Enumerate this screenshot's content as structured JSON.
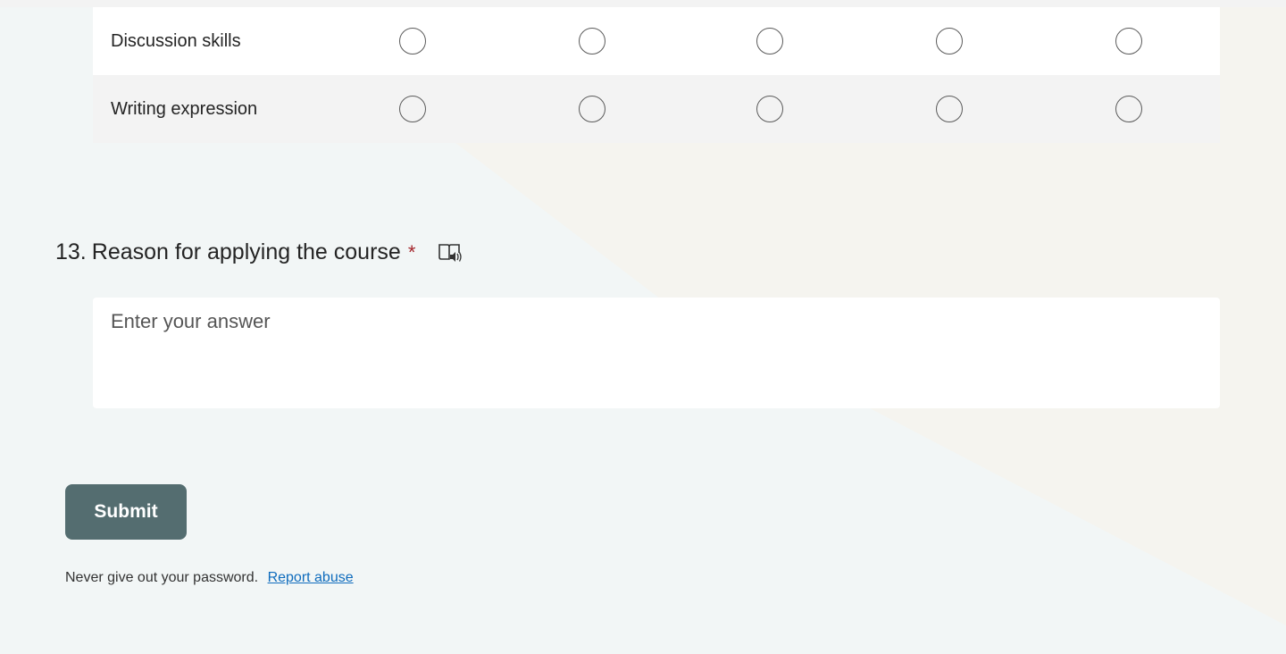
{
  "matrix": {
    "column_count": 5,
    "rows": [
      {
        "label": "Discussion skills"
      },
      {
        "label": "Writing expression"
      }
    ]
  },
  "question": {
    "number": "13.",
    "title": "Reason for applying the course",
    "required_mark": "*",
    "answer_placeholder": "Enter your answer"
  },
  "submit_label": "Submit",
  "footer": {
    "notice": "Never give out your password.",
    "report_link": "Report abuse"
  },
  "colors": {
    "submit_bg": "#546d70",
    "link": "#0f6cbd",
    "required": "#a4262c"
  },
  "icons": {
    "reader": "immersive-reader-icon"
  }
}
